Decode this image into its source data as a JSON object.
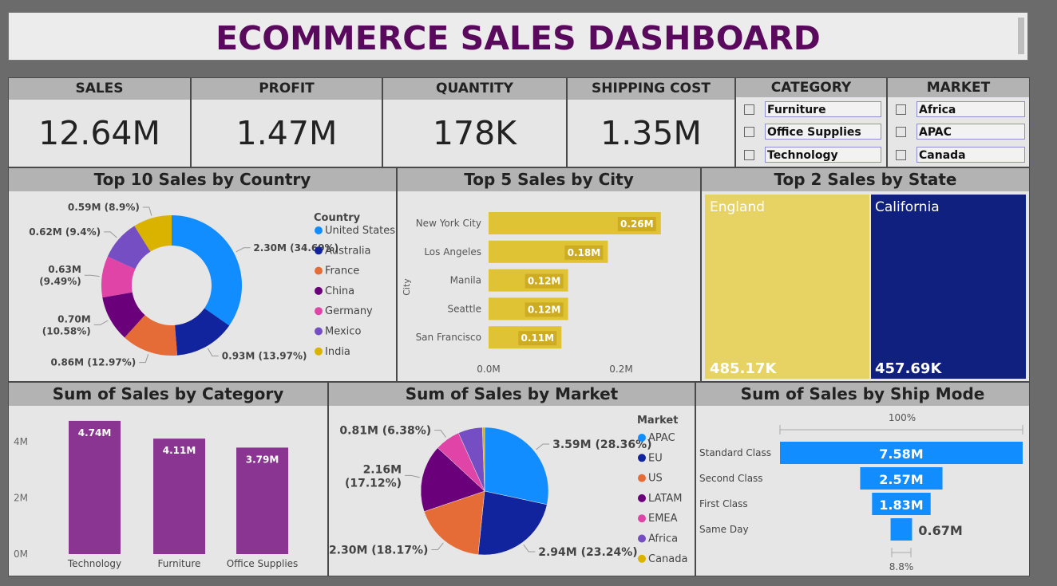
{
  "header": {
    "title": "ECOMMERCE SALES DASHBOARD"
  },
  "kpis": [
    {
      "label": "SALES",
      "value": "12.64M"
    },
    {
      "label": "PROFIT",
      "value": "1.47M"
    },
    {
      "label": "QUANTITY",
      "value": "178K"
    },
    {
      "label": "SHIPPING COST",
      "value": "1.35M"
    }
  ],
  "slicers": {
    "category": {
      "title": "CATEGORY",
      "items": [
        "Furniture",
        "Office Supplies",
        "Technology"
      ]
    },
    "market": {
      "title": "MARKET",
      "items": [
        "Africa",
        "APAC",
        "Canada"
      ]
    }
  },
  "colors": {
    "accent_title": "#5a0a5c",
    "bar_yellow": "#e0c235",
    "bar_purple": "#8b3592",
    "funnel_blue": "#118dff",
    "state_left": "#e7d264",
    "state_right": "#10207e"
  },
  "chart_data": [
    {
      "type": "pie",
      "donut": true,
      "title": "Top 10 Sales by Country",
      "legend_title": "Country",
      "legend_position": "right",
      "slices": [
        {
          "label": "United States",
          "value": 2.3,
          "percent": 34.69,
          "text": "2.30M (34.69%)",
          "color": "#118dff"
        },
        {
          "label": "Australia",
          "value": 0.93,
          "percent": 13.97,
          "text": "0.93M (13.97%)",
          "color": "#12239e"
        },
        {
          "label": "France",
          "value": 0.86,
          "percent": 12.97,
          "text": "0.86M (12.97%)",
          "color": "#e66c37"
        },
        {
          "label": "China",
          "value": 0.7,
          "percent": 10.58,
          "text": "0.70M (10.58%)",
          "color": "#6b007b"
        },
        {
          "label": "Germany",
          "value": 0.63,
          "percent": 9.49,
          "text": "0.63M (9.49%)",
          "color": "#e044a7"
        },
        {
          "label": "Mexico",
          "value": 0.62,
          "percent": 9.4,
          "text": "0.62M (9.4%)",
          "color": "#744ec2"
        },
        {
          "label": "India",
          "value": 0.59,
          "percent": 8.9,
          "text": "0.59M (8.9%)",
          "color": "#d9b300"
        }
      ]
    },
    {
      "type": "bar",
      "orientation": "horizontal",
      "title": "Top 5 Sales by City",
      "ylabel": "City",
      "categories": [
        "New York City",
        "Los Angeles",
        "Manila",
        "Seattle",
        "San Francisco"
      ],
      "values": [
        0.26,
        0.18,
        0.12,
        0.12,
        0.11
      ],
      "labels": [
        "0.26M",
        "0.18M",
        "0.12M",
        "0.12M",
        "0.11M"
      ],
      "xticks": [
        "0.0M",
        "0.2M"
      ],
      "xlim": [
        0,
        0.3
      ]
    },
    {
      "type": "treemap",
      "title": "Top 2 Sales by State",
      "items": [
        {
          "label": "England",
          "value": 485.17,
          "text": "485.17K"
        },
        {
          "label": "California",
          "value": 457.69,
          "text": "457.69K"
        }
      ]
    },
    {
      "type": "bar",
      "title": "Sum of Sales by Category",
      "categories": [
        "Technology",
        "Furniture",
        "Office Supplies"
      ],
      "values": [
        4.74,
        4.11,
        3.79
      ],
      "labels": [
        "4.74M",
        "4.11M",
        "3.79M"
      ],
      "yticks": [
        "0M",
        "2M",
        "4M"
      ],
      "ylim": [
        0,
        5
      ]
    },
    {
      "type": "pie",
      "title": "Sum of Sales by Market",
      "legend_title": "Market",
      "legend_position": "right",
      "slices": [
        {
          "label": "APAC",
          "value": 3.59,
          "percent": 28.36,
          "text": "3.59M (28.36%)",
          "color": "#118dff"
        },
        {
          "label": "EU",
          "value": 2.94,
          "percent": 23.24,
          "text": "2.94M (23.24%)",
          "color": "#12239e"
        },
        {
          "label": "US",
          "value": 2.3,
          "percent": 18.17,
          "text": "2.30M (18.17%)",
          "color": "#e66c37"
        },
        {
          "label": "LATAM",
          "value": 2.16,
          "percent": 17.12,
          "text": "2.16M (17.12%)",
          "color": "#6b007b"
        },
        {
          "label": "EMEA",
          "value": 0.81,
          "percent": 6.38,
          "text": "0.81M (6.38%)",
          "color": "#e044a7"
        },
        {
          "label": "Africa",
          "value": 0.78,
          "percent": 6.17,
          "text": "",
          "color": "#744ec2"
        },
        {
          "label": "Canada",
          "value": 0.07,
          "percent": 0.56,
          "text": "",
          "color": "#d9b300"
        }
      ]
    },
    {
      "type": "funnel",
      "title": "Sum of Sales by Ship Mode",
      "top_label": "100%",
      "bottom_label": "8.8%",
      "categories": [
        "Standard Class",
        "Second Class",
        "First Class",
        "Same Day"
      ],
      "values": [
        7.58,
        2.57,
        1.83,
        0.67
      ],
      "labels": [
        "7.58M",
        "2.57M",
        "1.83M",
        "0.67M"
      ]
    }
  ]
}
